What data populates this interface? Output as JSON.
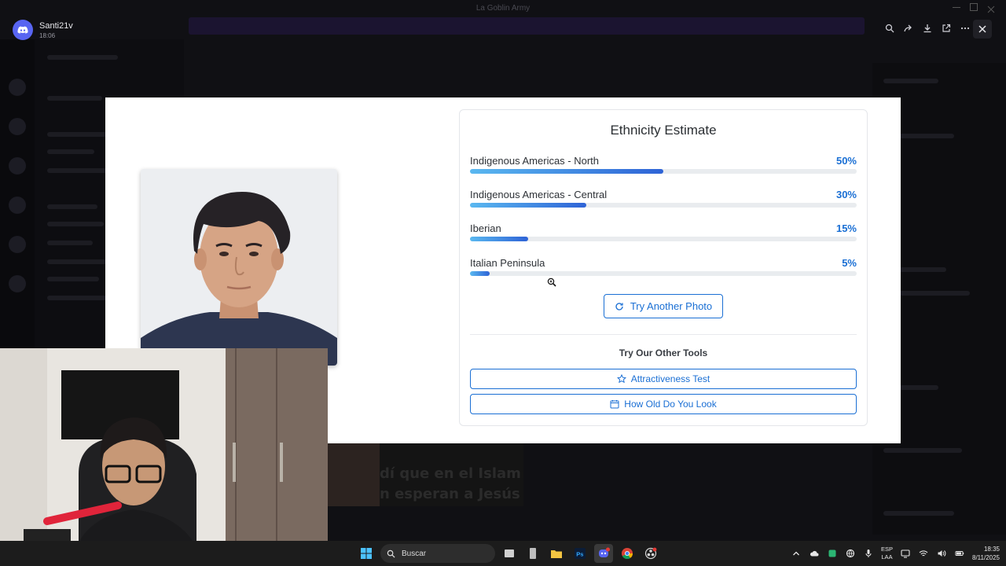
{
  "viewer": {
    "window_title": "La Goblin Army",
    "author": "Santi21v",
    "time": "18:06"
  },
  "result": {
    "title": "Ethnicity Estimate",
    "ethnicities": [
      {
        "name": "Indigenous Americas - North",
        "percent_label": "50%",
        "value": 50
      },
      {
        "name": "Indigenous Americas - Central",
        "percent_label": "30%",
        "value": 30
      },
      {
        "name": "Iberian",
        "percent_label": "15%",
        "value": 15
      },
      {
        "name": "Italian Peninsula",
        "percent_label": "5%",
        "value": 5
      }
    ],
    "try_another_label": "Try Another Photo",
    "other_tools_title": "Try Our Other Tools",
    "tools": [
      {
        "label": "Attractiveness Test",
        "icon": "star-icon"
      },
      {
        "label": "How Old Do You Look",
        "icon": "calendar-icon"
      }
    ]
  },
  "subtitles": {
    "line1": "dí que en el Islam",
    "line2": "n esperan a Jesús"
  },
  "taskbar": {
    "search_label": "Buscar",
    "lang_line1": "ESP",
    "lang_line2": "LAA",
    "time": "18:35",
    "date": "8/11/2025"
  },
  "colors": {
    "accent": "#1a6fd4",
    "bar_start": "#5ab8f0",
    "bar_end": "#2e63d6",
    "discord_blurple": "#5865f2"
  }
}
